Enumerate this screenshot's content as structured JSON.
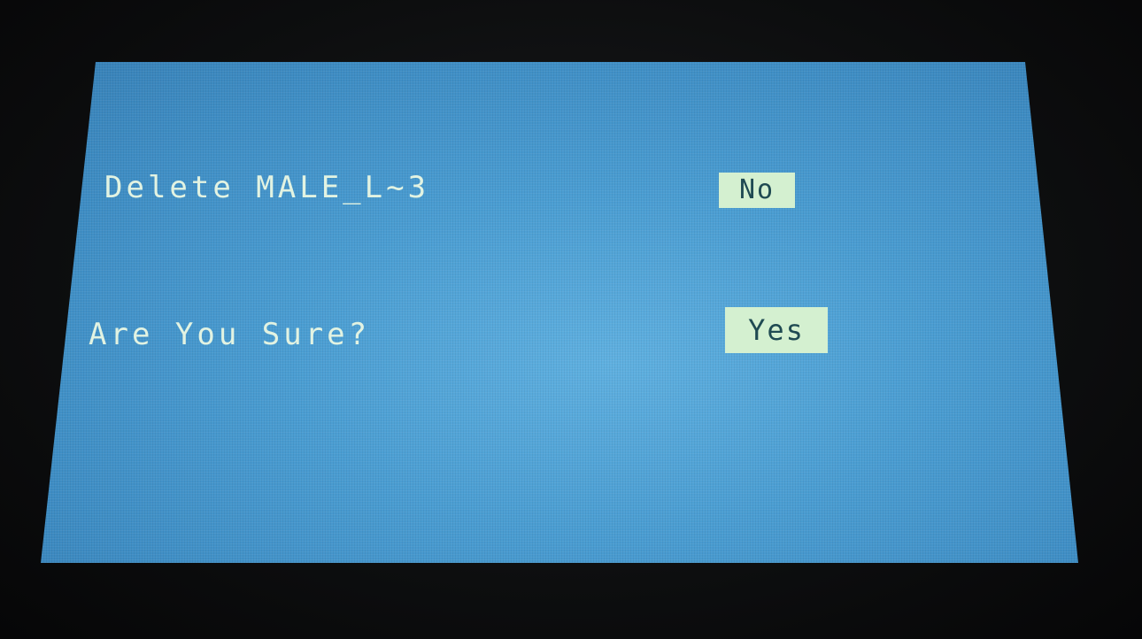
{
  "dialog": {
    "message": "Delete MALE_L~3",
    "question": "Are You Sure?",
    "no_label": "No",
    "yes_label": "Yes"
  },
  "colors": {
    "screen_background": "#4a9dd2",
    "text": "#e2f3e2",
    "button_background": "#d4f0d0",
    "button_text": "#1f4a52",
    "bezel": "#0d0e0f"
  }
}
